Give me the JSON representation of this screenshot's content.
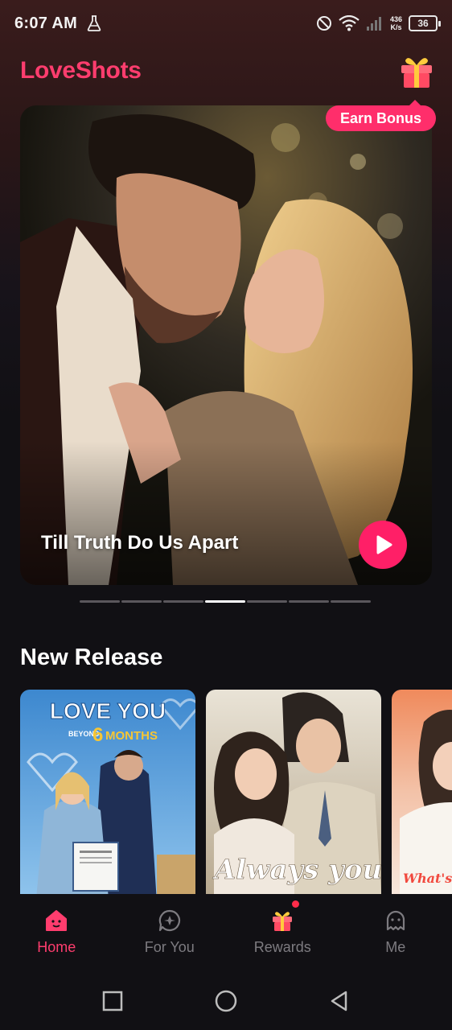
{
  "status_bar": {
    "time": "6:07 AM",
    "net_speed_value": "436",
    "net_speed_unit": "K/s",
    "battery": "36",
    "icons": [
      "flask-icon",
      "do-not-disturb-icon",
      "wifi-icon",
      "signal-icon",
      "battery-icon"
    ]
  },
  "header": {
    "title": "LoveShots",
    "gift_icon": "gift-icon"
  },
  "hero": {
    "title": "Till Truth Do Us Apart",
    "badge": "Earn Bonus",
    "play_icon": "play-icon",
    "carousel_count": 7,
    "carousel_active": 4
  },
  "new_release": {
    "title": "New Release",
    "cards": [
      {
        "poster_text": "LOVE YOU",
        "poster_sub": "BEYOND",
        "poster_sub2": "6",
        "poster_sub3": "MONTHS"
      },
      {
        "poster_text": "Always you"
      },
      {
        "poster_text": "What's Up"
      }
    ]
  },
  "bottom_nav": {
    "items": [
      {
        "label": "Home",
        "icon": "home-icon",
        "active": true
      },
      {
        "label": "For You",
        "icon": "for-you-icon",
        "active": false
      },
      {
        "label": "Rewards",
        "icon": "gift-icon",
        "active": false,
        "notification_dot": true
      },
      {
        "label": "Me",
        "icon": "profile-icon",
        "active": false
      }
    ]
  },
  "system_nav": [
    "recents-icon",
    "home-circle-icon",
    "back-icon"
  ],
  "colors": {
    "brand": "#ff3d6e",
    "accent_pink": "#ff1f67",
    "background": "#111014",
    "inactive_nav": "#7d7b80"
  }
}
